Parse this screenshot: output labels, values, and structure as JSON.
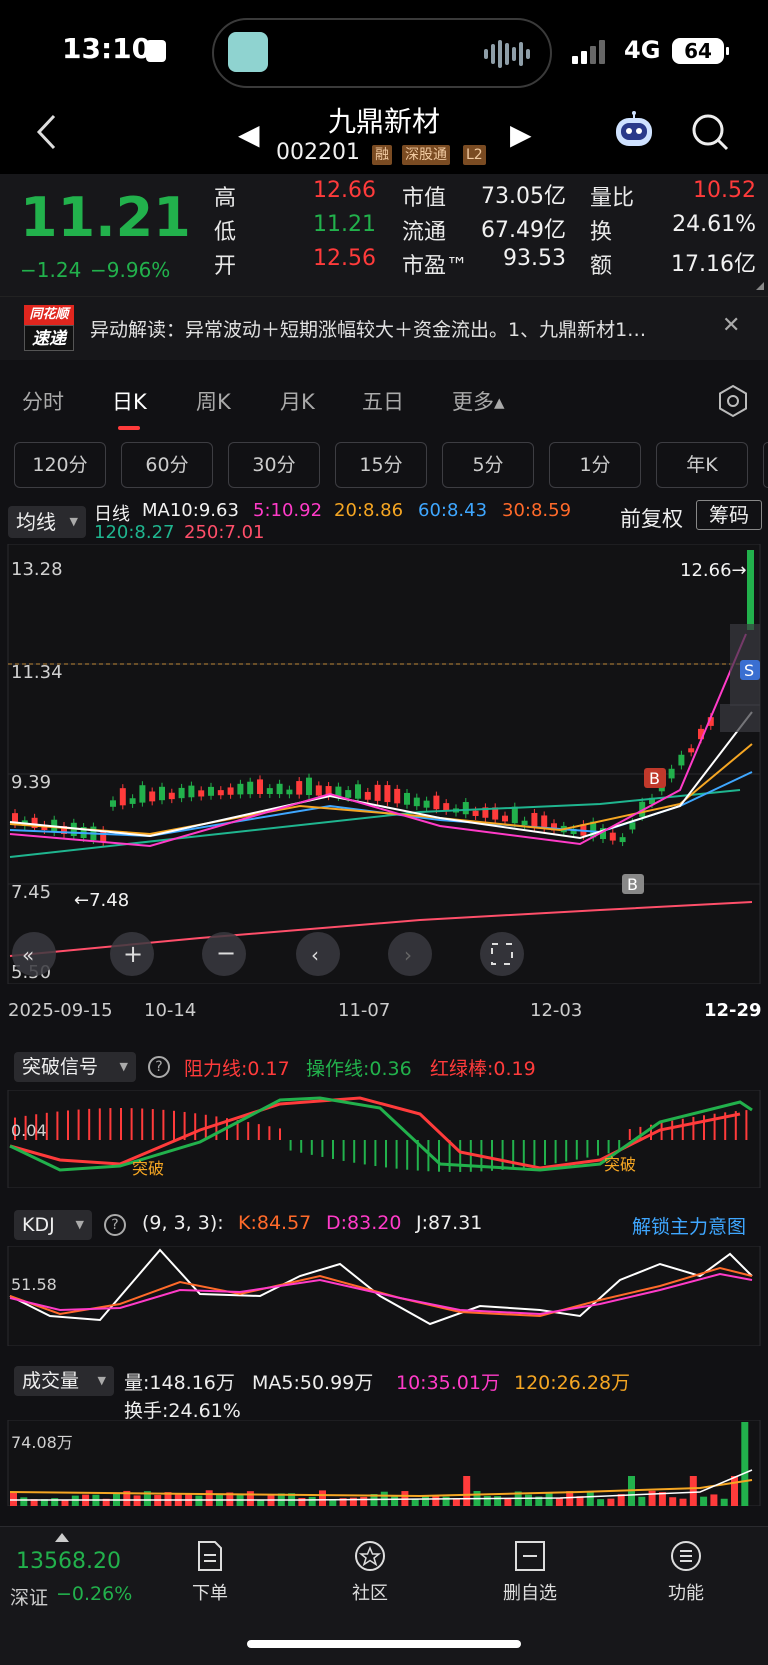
{
  "status_bar": {
    "time": "13:10",
    "network": "4G",
    "battery": "64"
  },
  "header": {
    "name": "九鼎新材",
    "code": "002201",
    "tags": [
      "融",
      "深股通",
      "L2"
    ]
  },
  "quote": {
    "price": "11.21",
    "change": "−1.24",
    "change_pct": "−9.96%",
    "high_label": "高",
    "high": "12.66",
    "low_label": "低",
    "low": "11.21",
    "open_label": "开",
    "open": "12.56",
    "mcap_label": "市值",
    "mcap": "73.05亿",
    "float_label": "流通",
    "float": "67.49亿",
    "pe_label": "市盈™",
    "pe": "93.53",
    "vr_label": "量比",
    "vr": "10.52",
    "turn_label": "换",
    "turn": "24.61%",
    "amt_label": "额",
    "amt": "17.16亿"
  },
  "news": {
    "logo_top": "同花顺",
    "logo_bottom": "速递",
    "text": "异动解读：异常波动＋短期涨幅较大＋资金流出。1、九鼎新材1…"
  },
  "tabs": [
    "分时",
    "日K",
    "周K",
    "月K",
    "五日",
    "更多▴"
  ],
  "periods": [
    "120分",
    "60分",
    "30分",
    "15分",
    "5分",
    "1分",
    "年K"
  ],
  "ma_legend": {
    "selector": "均线",
    "label": "日线",
    "ma10": "MA10:9.63",
    "ma5": "5:10.92",
    "ma20": "20:8.86",
    "ma60": "60:8.43",
    "ma30": "30:8.59",
    "ma120": "120:8.27",
    "ma250": "250:7.01",
    "adjust": "前复权",
    "chips": "筹码"
  },
  "colors": {
    "up": "#ff3b3b",
    "down": "#22b14c",
    "ma5": "#ff3bc8",
    "ma10": "#ffffff",
    "ma20": "#f5a623",
    "ma30": "#ff6a2a",
    "ma60": "#3fa7ff",
    "ma120": "#1fb58f",
    "ma250": "#ff4f6a"
  },
  "chart_data": {
    "type": "candlestick",
    "y_ticks": [
      "13.28",
      "11.34",
      "9.39",
      "7.45",
      "5.50"
    ],
    "x_ticks": [
      "2025-09-15",
      "10-14",
      "11-07",
      "12-03",
      "12-29"
    ],
    "high_marker": "12.66→",
    "low_marker": "←7.48",
    "signals": [
      "B",
      "B",
      "S"
    ]
  },
  "breakout_panel": {
    "selector": "突破信号",
    "resist": "阻力线:0.17",
    "op": "操作线:0.36",
    "bar": "红绿棒:0.19",
    "level": "0.04",
    "marks": [
      "突破",
      "突破"
    ]
  },
  "kdj_panel": {
    "selector": "KDJ",
    "params": "(9, 3, 3):",
    "k": "K:84.57",
    "d": "D:83.20",
    "j": "J:87.31",
    "unlock": "解锁主力意图",
    "level": "51.58"
  },
  "volume_panel": {
    "selector": "成交量",
    "vol": "量:148.16万",
    "ma5": "MA5:50.99万",
    "ma10": "10:35.01万",
    "ma120": "120:26.28万",
    "turnover": "换手:24.61%",
    "level": "74.08万"
  },
  "bottom_nav": {
    "index_value": "13568.20",
    "index_name": "深证",
    "index_chg": "−0.26%",
    "items": [
      "下单",
      "社区",
      "删自选",
      "功能"
    ]
  }
}
